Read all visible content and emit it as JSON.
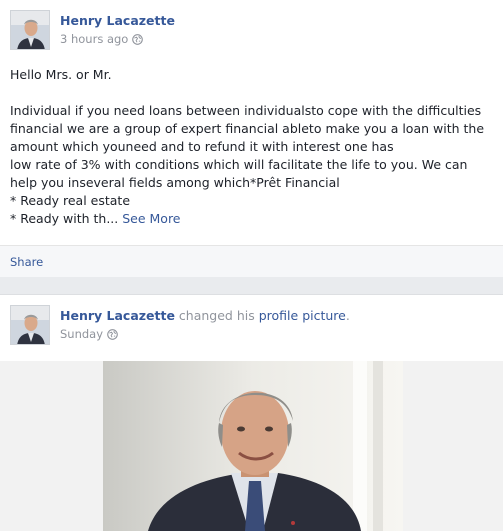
{
  "posts": [
    {
      "author": "Henry Lacazette",
      "timestamp": "3 hours ago",
      "privacy_icon": "globe-icon",
      "greeting": "Hello Mrs. or Mr.",
      "body_lines": [
        "Individual if you need loans between individualsto cope with the difficulties",
        "financial we are a group of expert financial ableto make you a loan with the",
        "amount which youneed and to refund it with interest one has",
        "low rate of 3% with conditions which will facilitate the life to you. We can",
        "help you inseveral fields among which*Prêt Financial",
        "* Ready real estate"
      ],
      "last_line": "* Ready with th... ",
      "see_more": "See More",
      "share_label": "Share"
    },
    {
      "author": "Henry Lacazette",
      "action_text": "changed his",
      "action_link": "profile picture",
      "action_suffix": ".",
      "timestamp": "Sunday",
      "privacy_icon": "globe-icon"
    }
  ],
  "colors": {
    "link": "#365899",
    "muted": "#90949c",
    "text": "#1d2129",
    "background": "#e9ebee"
  }
}
